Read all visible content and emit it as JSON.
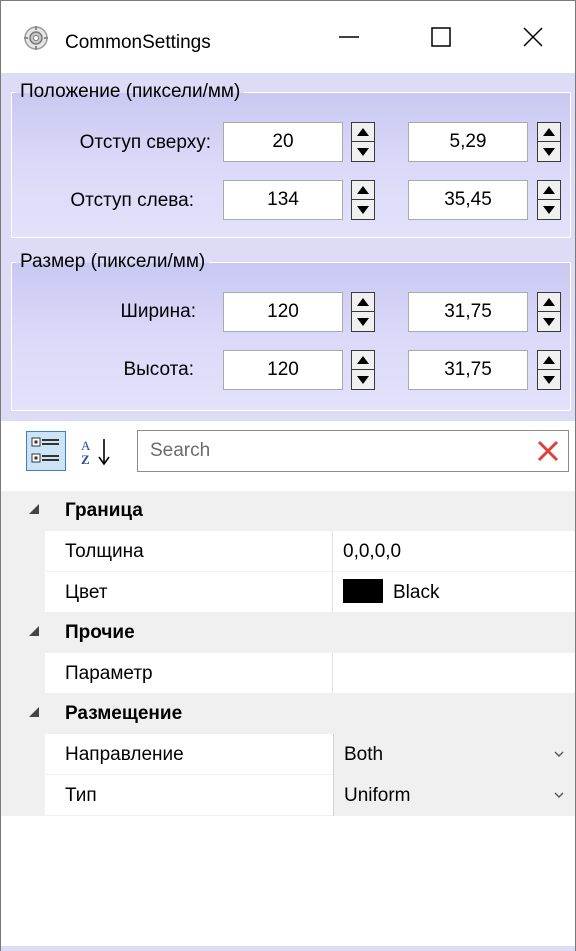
{
  "window": {
    "title": "CommonSettings",
    "icon": "settings-app-icon",
    "controls": [
      "minimize-icon",
      "maximize-icon",
      "close-icon"
    ]
  },
  "position_group": {
    "legend": "Положение (пиксели/мм)",
    "rows": [
      {
        "label": "Отступ сверху:",
        "pixels": "20",
        "mm": "5,29"
      },
      {
        "label": "Отступ слева:",
        "pixels": "134",
        "mm": "35,45"
      }
    ]
  },
  "size_group": {
    "legend": "Размер (пиксели/мм)",
    "rows": [
      {
        "label": "Ширина:",
        "pixels": "120",
        "mm": "31,75"
      },
      {
        "label": "Высота:",
        "pixels": "120",
        "mm": "31,75"
      }
    ]
  },
  "toolbar": {
    "categorized_icon": "categorized-view-icon",
    "sort_icon": "sort-alphabetical-icon",
    "search_placeholder": "Search",
    "clear_icon": "clear-search-icon"
  },
  "property_grid": {
    "categories": [
      {
        "name": "Граница",
        "props": [
          {
            "name": "Толщина",
            "value": "0,0,0,0"
          },
          {
            "name": "Цвет",
            "value": "Black",
            "swatch": "#000000"
          }
        ]
      },
      {
        "name": "Прочие",
        "props": [
          {
            "name": "Параметр",
            "value": ""
          }
        ]
      },
      {
        "name": "Размещение",
        "props": [
          {
            "name": "Направление",
            "value": "Both"
          },
          {
            "name": "Тип",
            "value": "Uniform"
          }
        ]
      }
    ]
  },
  "colors": {
    "panel_blue": "#dcdcf6",
    "category_gray": "#f0f0f0",
    "clear_red": "#e0403a"
  }
}
